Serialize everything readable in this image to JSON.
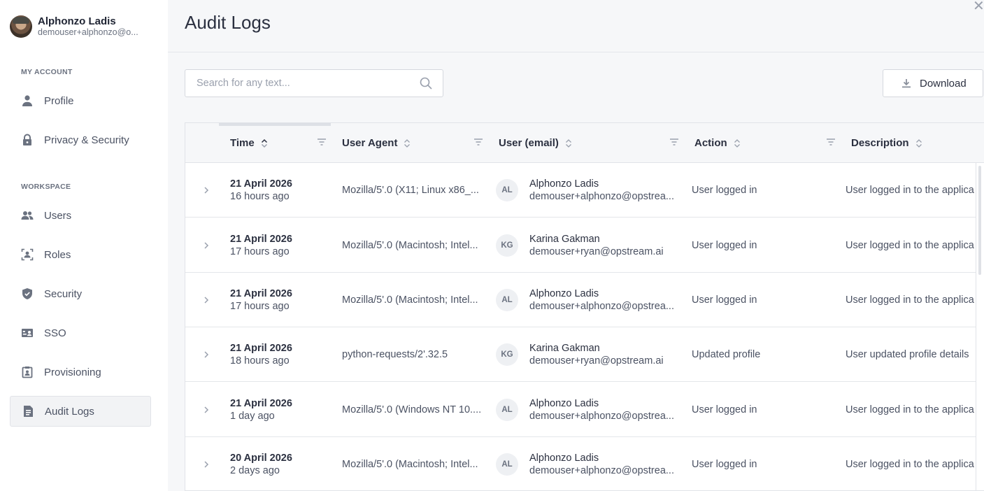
{
  "user": {
    "name": "Alphonzo Ladis",
    "email": "demouser+alphonzo@o..."
  },
  "sidebar": {
    "my_account_label": "MY ACCOUNT",
    "workspace_label": "WORKSPACE",
    "items": [
      {
        "label": "Profile",
        "icon": "person-icon"
      },
      {
        "label": "Privacy & Security",
        "icon": "lock-icon"
      },
      {
        "label": "Users",
        "icon": "users-icon"
      },
      {
        "label": "Roles",
        "icon": "roles-icon"
      },
      {
        "label": "Security",
        "icon": "shield-icon"
      },
      {
        "label": "SSO",
        "icon": "sso-icon"
      },
      {
        "label": "Provisioning",
        "icon": "provisioning-icon"
      },
      {
        "label": "Audit Logs",
        "icon": "document-icon",
        "active": true
      }
    ]
  },
  "main": {
    "title": "Audit Logs",
    "search_placeholder": "Search for any text...",
    "download_label": "Download"
  },
  "table": {
    "columns": [
      "Time",
      "User Agent",
      "User (email)",
      "Action",
      "Description"
    ],
    "rows": [
      {
        "date": "21 April 2026",
        "ago": "16 hours ago",
        "agent": "Mozilla/5'.0 (X11; Linux x86_...",
        "initials": "AL",
        "name": "Alphonzo Ladis",
        "email": "demouser+alphonzo@opstrea...",
        "action": "User logged in",
        "description": "User logged in to the applica"
      },
      {
        "date": "21 April 2026",
        "ago": "17 hours ago",
        "agent": "Mozilla/5'.0 (Macintosh; Intel...",
        "initials": "KG",
        "name": "Karina Gakman",
        "email": "demouser+ryan@opstream.ai",
        "action": "User logged in",
        "description": "User logged in to the applica"
      },
      {
        "date": "21 April 2026",
        "ago": "17 hours ago",
        "agent": "Mozilla/5'.0 (Macintosh; Intel...",
        "initials": "AL",
        "name": "Alphonzo Ladis",
        "email": "demouser+alphonzo@opstrea...",
        "action": "User logged in",
        "description": "User logged in to the applica"
      },
      {
        "date": "21 April 2026",
        "ago": "18 hours ago",
        "agent": "python-requests/2'.32.5",
        "initials": "KG",
        "name": "Karina Gakman",
        "email": "demouser+ryan@opstream.ai",
        "action": "Updated profile",
        "description": "User updated profile details"
      },
      {
        "date": "21 April 2026",
        "ago": "1 day ago",
        "agent": "Mozilla/5'.0 (Windows NT 10....",
        "initials": "AL",
        "name": "Alphonzo Ladis",
        "email": "demouser+alphonzo@opstrea...",
        "action": "User logged in",
        "description": "User logged in to the applica"
      },
      {
        "date": "20 April 2026",
        "ago": "2 days ago",
        "agent": "Mozilla/5'.0 (Macintosh; Intel...",
        "initials": "AL",
        "name": "Alphonzo Ladis",
        "email": "demouser+alphonzo@opstrea...",
        "action": "User logged in",
        "description": "User logged in to the applica"
      }
    ]
  }
}
